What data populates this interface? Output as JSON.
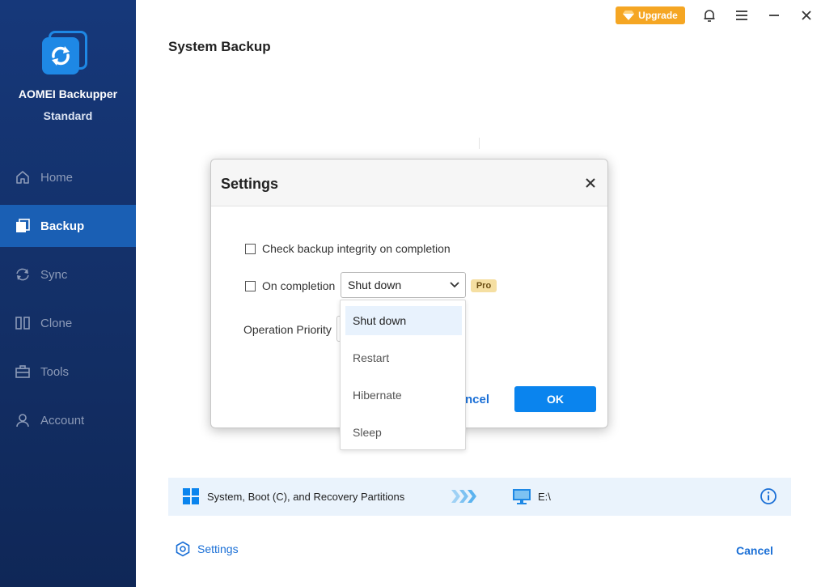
{
  "app": {
    "name": "AOMEI Backupper",
    "edition": "Standard"
  },
  "topbar": {
    "upgrade_label": "Upgrade",
    "icons": [
      "bell-icon",
      "menu-icon",
      "minimize-icon",
      "close-icon"
    ]
  },
  "sidebar": {
    "items": [
      {
        "label": "Home",
        "icon": "home-icon"
      },
      {
        "label": "Backup",
        "icon": "backup-icon"
      },
      {
        "label": "Sync",
        "icon": "sync-icon"
      },
      {
        "label": "Clone",
        "icon": "clone-icon"
      },
      {
        "label": "Tools",
        "icon": "tools-icon"
      },
      {
        "label": "Account",
        "icon": "account-icon"
      }
    ],
    "active": "Backup"
  },
  "page": {
    "title": "System Backup",
    "source": "System, Boot (C), and Recovery Partitions",
    "destination": "E:\\",
    "settings_label": "Settings",
    "cancel_label": "Cancel"
  },
  "modal": {
    "title": "Settings",
    "check_integrity_label": "Check backup integrity on completion",
    "check_integrity_checked": false,
    "on_completion_label": "On completion",
    "on_completion_checked": false,
    "on_completion_value": "Shut down",
    "pro_badge": "Pro",
    "priority_label": "Operation Priority",
    "cancel_label_visible": "ncel",
    "ok_label": "OK"
  },
  "dropdown": {
    "options": [
      "Shut down",
      "Restart",
      "Hibernate",
      "Sleep"
    ],
    "highlighted": "Shut down"
  },
  "colors": {
    "sidebar_bg": "#132f66",
    "active_nav": "#1a5fb4",
    "accent_blue": "#0a84ee",
    "upgrade_orange": "#f5a623",
    "pro_badge": "#f5dfa2",
    "path_bar_bg": "#eaf3fc"
  }
}
